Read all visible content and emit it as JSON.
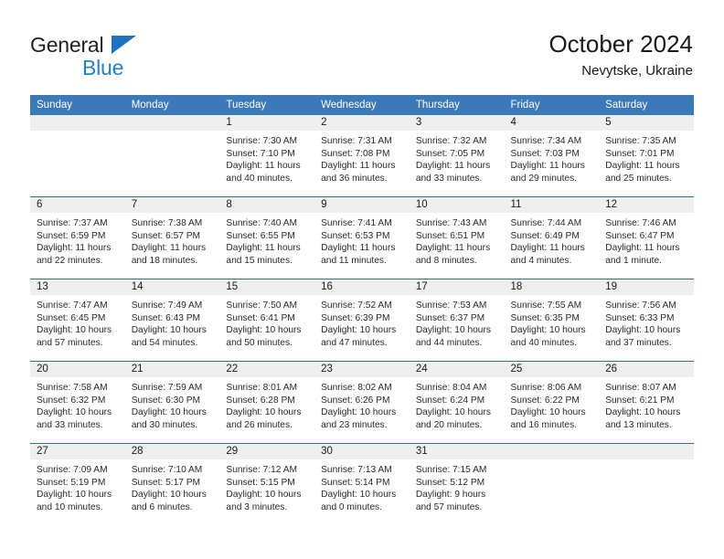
{
  "brand": {
    "name_top": "General",
    "name_bottom": "Blue",
    "triangle_color": "#1f72bd",
    "top_color": "#231f20",
    "bottom_color": "#2581c4"
  },
  "header": {
    "title": "October 2024",
    "subtitle": "Nevytske, Ukraine",
    "header_bg": "#3b79b8",
    "row_divider": "#2e6da8",
    "daystrip_bg": "#efefef"
  },
  "weekdays": [
    "Sunday",
    "Monday",
    "Tuesday",
    "Wednesday",
    "Thursday",
    "Friday",
    "Saturday"
  ],
  "labels": {
    "sunrise_prefix": "Sunrise:",
    "sunset_prefix": "Sunset:",
    "daylight_prefix": "Daylight:"
  },
  "weeks": [
    [
      {
        "empty": true
      },
      {
        "empty": true
      },
      {
        "day": "1",
        "sunrise": "Sunrise: 7:30 AM",
        "sunset": "Sunset: 7:10 PM",
        "daylight_1": "Daylight: 11 hours",
        "daylight_2": "and 40 minutes."
      },
      {
        "day": "2",
        "sunrise": "Sunrise: 7:31 AM",
        "sunset": "Sunset: 7:08 PM",
        "daylight_1": "Daylight: 11 hours",
        "daylight_2": "and 36 minutes."
      },
      {
        "day": "3",
        "sunrise": "Sunrise: 7:32 AM",
        "sunset": "Sunset: 7:05 PM",
        "daylight_1": "Daylight: 11 hours",
        "daylight_2": "and 33 minutes."
      },
      {
        "day": "4",
        "sunrise": "Sunrise: 7:34 AM",
        "sunset": "Sunset: 7:03 PM",
        "daylight_1": "Daylight: 11 hours",
        "daylight_2": "and 29 minutes."
      },
      {
        "day": "5",
        "sunrise": "Sunrise: 7:35 AM",
        "sunset": "Sunset: 7:01 PM",
        "daylight_1": "Daylight: 11 hours",
        "daylight_2": "and 25 minutes."
      }
    ],
    [
      {
        "day": "6",
        "sunrise": "Sunrise: 7:37 AM",
        "sunset": "Sunset: 6:59 PM",
        "daylight_1": "Daylight: 11 hours",
        "daylight_2": "and 22 minutes."
      },
      {
        "day": "7",
        "sunrise": "Sunrise: 7:38 AM",
        "sunset": "Sunset: 6:57 PM",
        "daylight_1": "Daylight: 11 hours",
        "daylight_2": "and 18 minutes."
      },
      {
        "day": "8",
        "sunrise": "Sunrise: 7:40 AM",
        "sunset": "Sunset: 6:55 PM",
        "daylight_1": "Daylight: 11 hours",
        "daylight_2": "and 15 minutes."
      },
      {
        "day": "9",
        "sunrise": "Sunrise: 7:41 AM",
        "sunset": "Sunset: 6:53 PM",
        "daylight_1": "Daylight: 11 hours",
        "daylight_2": "and 11 minutes."
      },
      {
        "day": "10",
        "sunrise": "Sunrise: 7:43 AM",
        "sunset": "Sunset: 6:51 PM",
        "daylight_1": "Daylight: 11 hours",
        "daylight_2": "and 8 minutes."
      },
      {
        "day": "11",
        "sunrise": "Sunrise: 7:44 AM",
        "sunset": "Sunset: 6:49 PM",
        "daylight_1": "Daylight: 11 hours",
        "daylight_2": "and 4 minutes."
      },
      {
        "day": "12",
        "sunrise": "Sunrise: 7:46 AM",
        "sunset": "Sunset: 6:47 PM",
        "daylight_1": "Daylight: 11 hours",
        "daylight_2": "and 1 minute."
      }
    ],
    [
      {
        "day": "13",
        "sunrise": "Sunrise: 7:47 AM",
        "sunset": "Sunset: 6:45 PM",
        "daylight_1": "Daylight: 10 hours",
        "daylight_2": "and 57 minutes."
      },
      {
        "day": "14",
        "sunrise": "Sunrise: 7:49 AM",
        "sunset": "Sunset: 6:43 PM",
        "daylight_1": "Daylight: 10 hours",
        "daylight_2": "and 54 minutes."
      },
      {
        "day": "15",
        "sunrise": "Sunrise: 7:50 AM",
        "sunset": "Sunset: 6:41 PM",
        "daylight_1": "Daylight: 10 hours",
        "daylight_2": "and 50 minutes."
      },
      {
        "day": "16",
        "sunrise": "Sunrise: 7:52 AM",
        "sunset": "Sunset: 6:39 PM",
        "daylight_1": "Daylight: 10 hours",
        "daylight_2": "and 47 minutes."
      },
      {
        "day": "17",
        "sunrise": "Sunrise: 7:53 AM",
        "sunset": "Sunset: 6:37 PM",
        "daylight_1": "Daylight: 10 hours",
        "daylight_2": "and 44 minutes."
      },
      {
        "day": "18",
        "sunrise": "Sunrise: 7:55 AM",
        "sunset": "Sunset: 6:35 PM",
        "daylight_1": "Daylight: 10 hours",
        "daylight_2": "and 40 minutes."
      },
      {
        "day": "19",
        "sunrise": "Sunrise: 7:56 AM",
        "sunset": "Sunset: 6:33 PM",
        "daylight_1": "Daylight: 10 hours",
        "daylight_2": "and 37 minutes."
      }
    ],
    [
      {
        "day": "20",
        "sunrise": "Sunrise: 7:58 AM",
        "sunset": "Sunset: 6:32 PM",
        "daylight_1": "Daylight: 10 hours",
        "daylight_2": "and 33 minutes."
      },
      {
        "day": "21",
        "sunrise": "Sunrise: 7:59 AM",
        "sunset": "Sunset: 6:30 PM",
        "daylight_1": "Daylight: 10 hours",
        "daylight_2": "and 30 minutes."
      },
      {
        "day": "22",
        "sunrise": "Sunrise: 8:01 AM",
        "sunset": "Sunset: 6:28 PM",
        "daylight_1": "Daylight: 10 hours",
        "daylight_2": "and 26 minutes."
      },
      {
        "day": "23",
        "sunrise": "Sunrise: 8:02 AM",
        "sunset": "Sunset: 6:26 PM",
        "daylight_1": "Daylight: 10 hours",
        "daylight_2": "and 23 minutes."
      },
      {
        "day": "24",
        "sunrise": "Sunrise: 8:04 AM",
        "sunset": "Sunset: 6:24 PM",
        "daylight_1": "Daylight: 10 hours",
        "daylight_2": "and 20 minutes."
      },
      {
        "day": "25",
        "sunrise": "Sunrise: 8:06 AM",
        "sunset": "Sunset: 6:22 PM",
        "daylight_1": "Daylight: 10 hours",
        "daylight_2": "and 16 minutes."
      },
      {
        "day": "26",
        "sunrise": "Sunrise: 8:07 AM",
        "sunset": "Sunset: 6:21 PM",
        "daylight_1": "Daylight: 10 hours",
        "daylight_2": "and 13 minutes."
      }
    ],
    [
      {
        "day": "27",
        "sunrise": "Sunrise: 7:09 AM",
        "sunset": "Sunset: 5:19 PM",
        "daylight_1": "Daylight: 10 hours",
        "daylight_2": "and 10 minutes."
      },
      {
        "day": "28",
        "sunrise": "Sunrise: 7:10 AM",
        "sunset": "Sunset: 5:17 PM",
        "daylight_1": "Daylight: 10 hours",
        "daylight_2": "and 6 minutes."
      },
      {
        "day": "29",
        "sunrise": "Sunrise: 7:12 AM",
        "sunset": "Sunset: 5:15 PM",
        "daylight_1": "Daylight: 10 hours",
        "daylight_2": "and 3 minutes."
      },
      {
        "day": "30",
        "sunrise": "Sunrise: 7:13 AM",
        "sunset": "Sunset: 5:14 PM",
        "daylight_1": "Daylight: 10 hours",
        "daylight_2": "and 0 minutes."
      },
      {
        "day": "31",
        "sunrise": "Sunrise: 7:15 AM",
        "sunset": "Sunset: 5:12 PM",
        "daylight_1": "Daylight: 9 hours",
        "daylight_2": "and 57 minutes."
      },
      {
        "empty": true
      },
      {
        "empty": true
      }
    ]
  ]
}
